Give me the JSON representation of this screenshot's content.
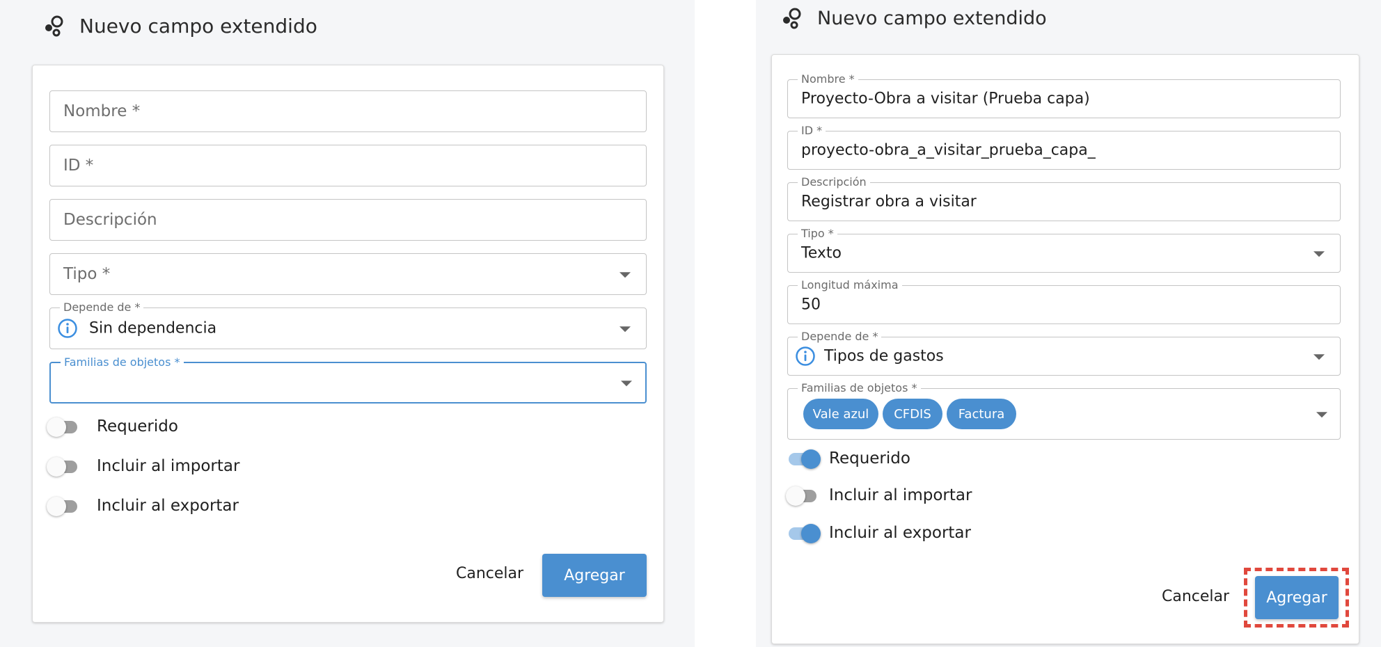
{
  "header": {
    "title": "Nuevo campo extendido",
    "icon": "settings-bubbles-icon"
  },
  "colors": {
    "accent": "#4a8fd0",
    "highlight": "#e0483d",
    "background": "#f5f6f8"
  },
  "left_form": {
    "nombre": {
      "placeholder": "Nombre *"
    },
    "id": {
      "placeholder": "ID *"
    },
    "descripcion": {
      "placeholder": "Descripción"
    },
    "tipo": {
      "placeholder": "Tipo *"
    },
    "depende_de": {
      "label": "Depende de *",
      "value": "Sin dependencia"
    },
    "familias": {
      "label": "Familias de objetos *"
    },
    "toggles": [
      {
        "label": "Requerido",
        "on": false
      },
      {
        "label": "Incluir al importar",
        "on": false
      },
      {
        "label": "Incluir al exportar",
        "on": false
      }
    ],
    "cancel_label": "Cancelar",
    "add_label": "Agregar"
  },
  "right_form": {
    "nombre": {
      "label": "Nombre *",
      "value": "Proyecto-Obra a visitar (Prueba capa)"
    },
    "id": {
      "label": "ID *",
      "value": "proyecto-obra_a_visitar_prueba_capa_"
    },
    "descripcion": {
      "label": "Descripción",
      "value": "Registrar obra a visitar"
    },
    "tipo": {
      "label": "Tipo *",
      "value": "Texto"
    },
    "longitud": {
      "label": "Longitud máxima",
      "value": "50"
    },
    "depende_de": {
      "label": "Depende de *",
      "value": "Tipos de gastos"
    },
    "familias": {
      "label": "Familias de objetos *",
      "chips": [
        "Vale azul",
        "CFDIS",
        "Factura"
      ]
    },
    "toggles": [
      {
        "label": "Requerido",
        "on": true
      },
      {
        "label": "Incluir al importar",
        "on": false
      },
      {
        "label": "Incluir al exportar",
        "on": true
      }
    ],
    "cancel_label": "Cancelar",
    "add_label": "Agregar"
  }
}
